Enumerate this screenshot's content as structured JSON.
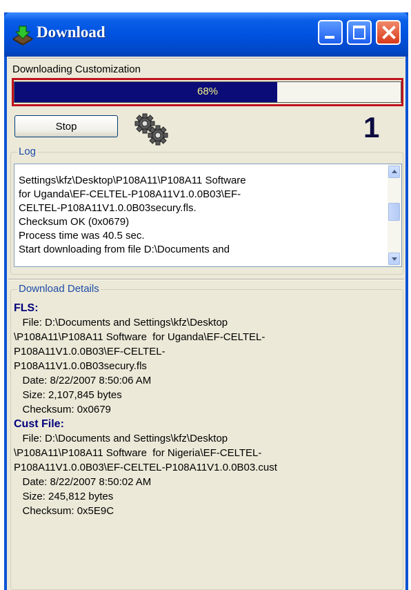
{
  "window": {
    "title": "Download",
    "icon": "download-icon",
    "controls": [
      "minimize-icon",
      "maximize-icon",
      "close-icon"
    ],
    "colors": {
      "titlebar": "#0052e0",
      "close": "#d8391a",
      "progress_fill": "#0c0c78",
      "highlight": "#c0121c",
      "group_label": "#1d4ca8"
    }
  },
  "status": {
    "text": "Downloading Customization"
  },
  "progress": {
    "value": 0.68,
    "label": "68%"
  },
  "actions": {
    "stop_label": "Stop",
    "gears_icon": "gears-icon"
  },
  "annotation": {
    "step_number": "1"
  },
  "log": {
    "label": "Log",
    "lines": [
      "Settings\\kfz\\Desktop\\P108A11\\P108A11 Software",
      "for Uganda\\EF-CELTEL-P108A11V1.0.0B03\\EF-",
      "CELTEL-P108A11V1.0.0B03secury.fls.",
      "Checksum OK (0x0679)",
      "Process time was 40.5 sec.",
      "Start downloading from file D:\\Documents and"
    ]
  },
  "details": {
    "label": "Download Details",
    "sections": [
      {
        "heading": "FLS:",
        "lines": [
          "   File: D:\\Documents and Settings\\kfz\\Desktop",
          "\\P108A11\\P108A11 Software  for Uganda\\EF-CELTEL-",
          "P108A11V1.0.0B03\\EF-CELTEL-",
          "P108A11V1.0.0B03secury.fls",
          "   Date: 8/22/2007 8:50:06 AM",
          "   Size: 2,107,845 bytes",
          "   Checksum: 0x0679"
        ]
      },
      {
        "heading": "Cust File:",
        "lines": [
          "   File: D:\\Documents and Settings\\kfz\\Desktop",
          "\\P108A11\\P108A11 Software  for Nigeria\\EF-CELTEL-",
          "P108A11V1.0.0B03\\EF-CELTEL-P108A11V1.0.0B03.cust",
          "   Date: 8/22/2007 8:50:02 AM",
          "   Size: 245,812 bytes",
          "   Checksum: 0x5E9C"
        ]
      }
    ]
  }
}
